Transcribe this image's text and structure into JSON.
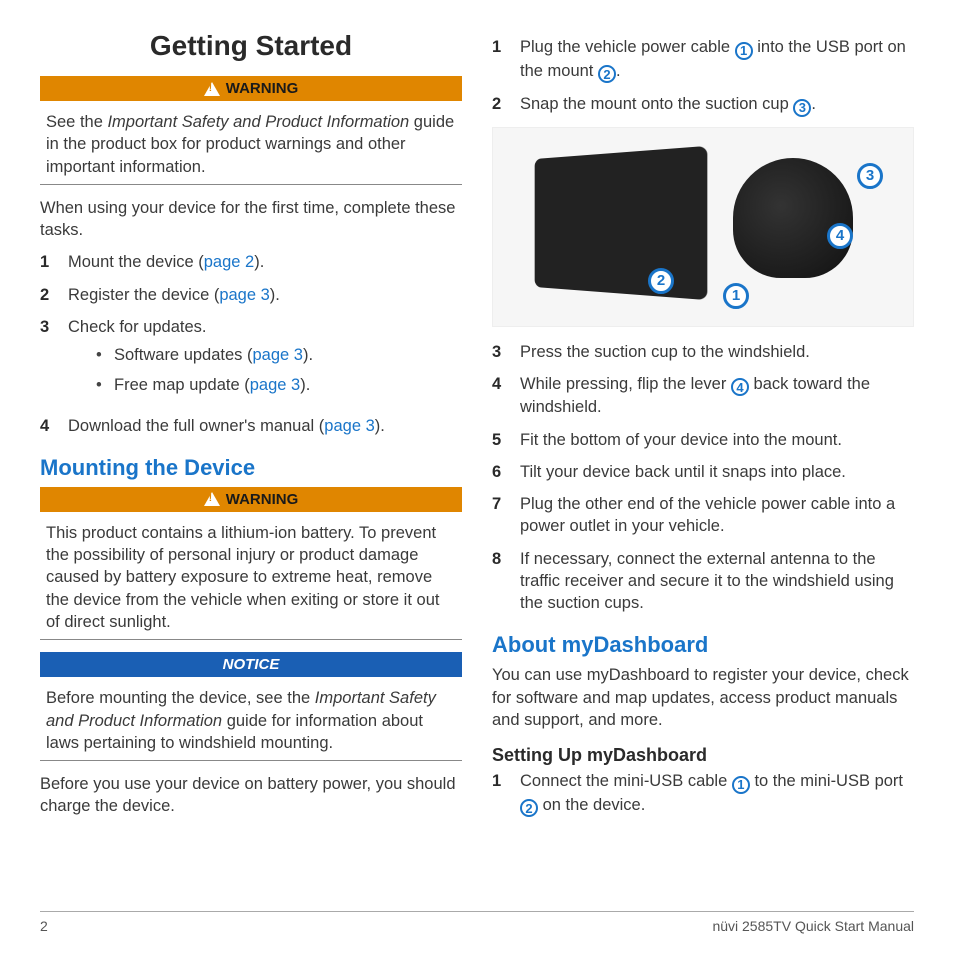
{
  "title": "Getting Started",
  "warning_label": "WARNING",
  "notice_label": "NOTICE",
  "col1": {
    "warn1": {
      "prefix": "See the ",
      "italic": "Important Safety and Product Information",
      "suffix": " guide in the product box for product warnings and other important information."
    },
    "intro": "When using your device for the first time, complete these tasks.",
    "steps": {
      "s1_a": "Mount the device (",
      "s1_link": "page 2",
      "s1_b": ").",
      "s2_a": "Register the device (",
      "s2_link": "page 3",
      "s2_b": ").",
      "s3": "Check for updates.",
      "s3_b1_a": "Software updates (",
      "s3_b1_link": "page 3",
      "s3_b1_b": ").",
      "s3_b2_a": "Free map update (",
      "s3_b2_link": "page 3",
      "s3_b2_b": ").",
      "s4_a": "Download the full owner's manual (",
      "s4_link": "page 3",
      "s4_b": ")."
    },
    "h2_mount": "Mounting the Device",
    "warn2": "This product contains a lithium-ion battery. To prevent the possibility of personal injury or product damage caused by battery exposure to extreme heat, remove the device from the vehicle when exiting or store it out of direct sunlight.",
    "notice": {
      "prefix": "Before mounting the device, see the ",
      "italic": "Important Safety and Product Information",
      "suffix": " guide for information about laws pertaining to windshield mounting."
    },
    "charge": "Before you use your device on battery power, you should charge the device."
  },
  "col2": {
    "steps1": {
      "s1_a": "Plug the vehicle power cable ",
      "s1_b": " into the USB port on the mount ",
      "s1_c": ".",
      "s2_a": "Snap the mount onto the suction cup ",
      "s2_b": "."
    },
    "diagram_badges": [
      "1",
      "2",
      "3",
      "4"
    ],
    "steps2": {
      "s3": "Press the suction cup to the windshield.",
      "s4_a": "While pressing, flip the lever ",
      "s4_b": " back toward the windshield.",
      "s5": "Fit the bottom of your device into the mount.",
      "s6": "Tilt your device back until it snaps into place.",
      "s7": "Plug the other end of the vehicle power cable into a power outlet in your vehicle.",
      "s8": "If necessary, connect the external antenna to the traffic receiver and secure it to the windshield using the suction cups."
    },
    "h2_dashboard": "About myDashboard",
    "dashboard_p": "You can use myDashboard to register your device, check for software and map updates, access product manuals and support, and more.",
    "h3_setup": "Setting Up myDashboard",
    "setup": {
      "s1_a": "Connect the mini-USB cable ",
      "s1_b": " to the mini-USB port ",
      "s1_c": " on the device."
    }
  },
  "footer": {
    "page": "2",
    "doc": "nüvi 2585TV Quick Start Manual"
  }
}
